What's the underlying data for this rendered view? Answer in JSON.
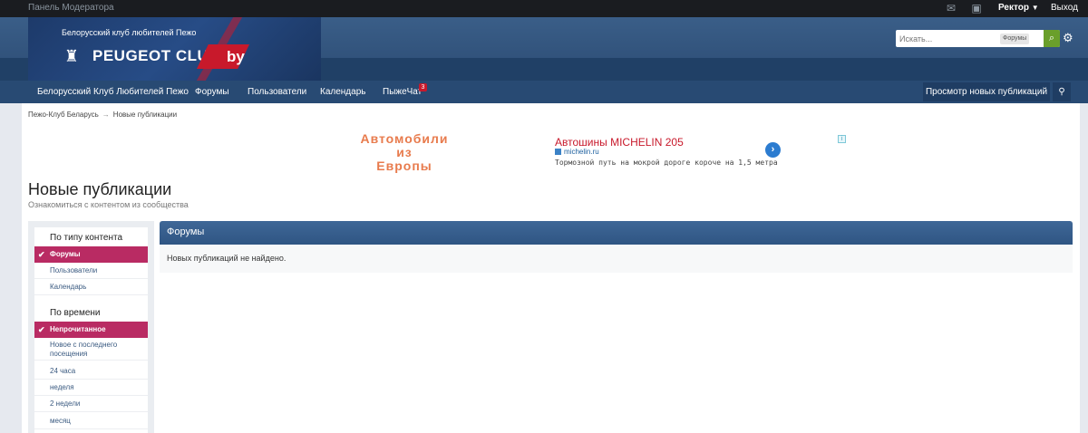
{
  "topbar": {
    "moderator_panel": "Панель Модератора",
    "user": "Ректор",
    "logout": "Выход"
  },
  "header": {
    "slogan": "Белорусский клуб любителей Пежо",
    "brand": "PEUGEOT CLUB",
    "brand_suffix": "by"
  },
  "search": {
    "placeholder": "Искать...",
    "scope": "Форумы"
  },
  "nav": {
    "items": [
      "Белорусский Клуб Любителей Пежо",
      "Форумы",
      "Пользователи",
      "Календарь",
      "ПыжеЧат"
    ],
    "chat_badge": "3",
    "new_posts": "Просмотр новых публикаций"
  },
  "breadcrumb": {
    "home": "Пежо-Клуб Беларусь",
    "current": "Новые публикации"
  },
  "ad": {
    "banner_lines": [
      "Автомобили",
      "из",
      "Европы"
    ],
    "title": "Автошины MICHELIN 205",
    "url": "michelin.ru",
    "text": "Тормозной путь на мокрой дороге короче на 1,5 метра"
  },
  "page": {
    "title": "Новые публикации",
    "subtitle": "Ознакомиться с контентом из сообщества"
  },
  "sidebar": {
    "by_type": {
      "heading": "По типу контента",
      "items": [
        "Форумы",
        "Пользователи",
        "Календарь"
      ]
    },
    "by_time": {
      "heading": "По времени",
      "items": [
        "Непрочитанное",
        "Новое с последнего",
        "посещения",
        "24 часа",
        "неделя",
        "2 недели",
        "месяц"
      ]
    }
  },
  "panel": {
    "title": "Форумы",
    "empty": "Новых публикаций не найдено."
  },
  "colors": {
    "active_filter": "#b92b63",
    "nav": "#284a73",
    "panel_header": "#3f6797"
  }
}
